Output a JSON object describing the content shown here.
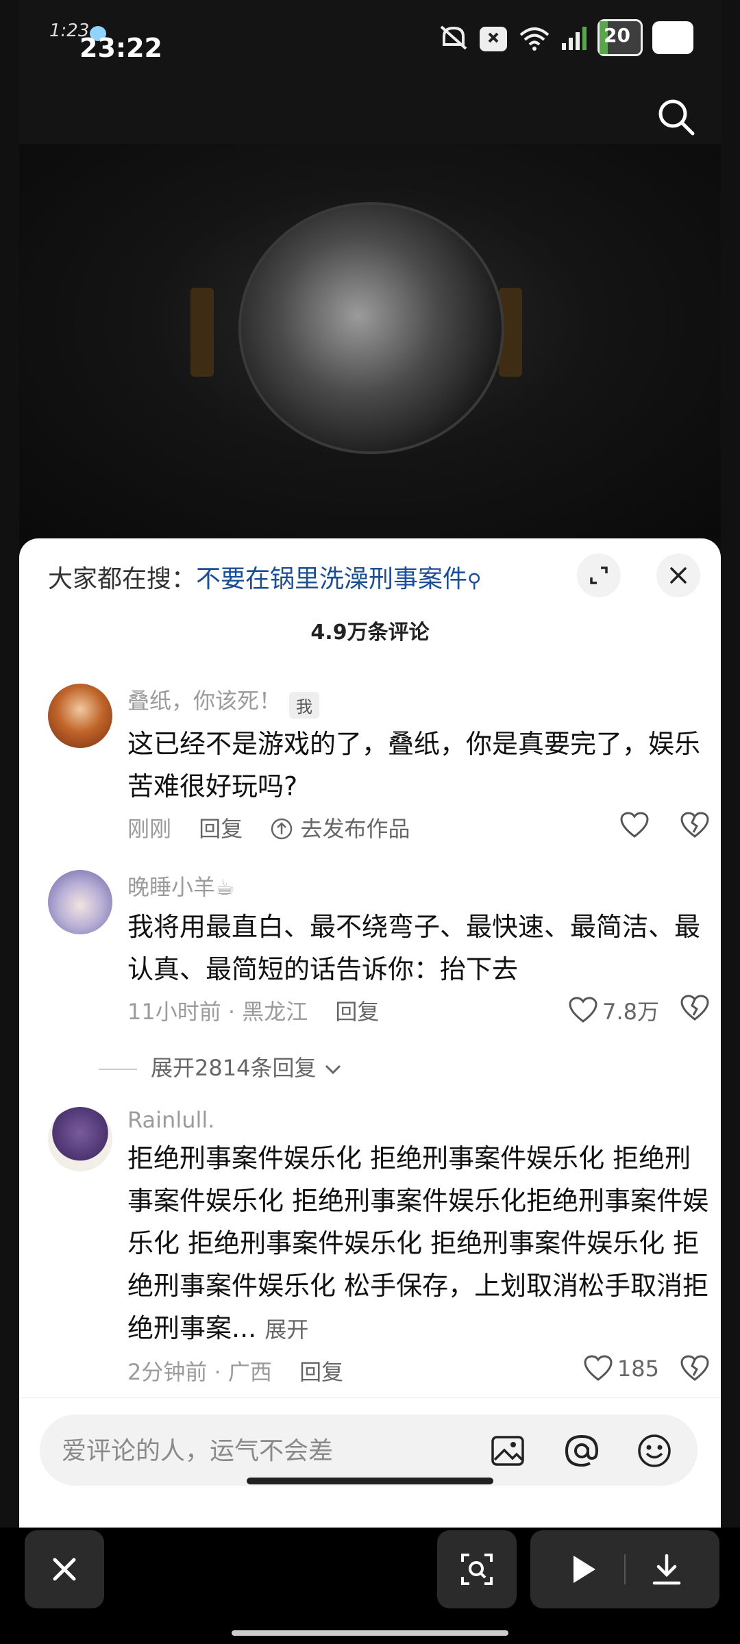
{
  "status_bar": {
    "small_time": "1:23",
    "time": "23:22",
    "battery": "20",
    "battery_level": 0.2
  },
  "hot_search": {
    "prefix": "大家都在搜：",
    "keyword": "不要在锅里洗澡刑事案件"
  },
  "comment_count": "4.9万条评论",
  "comments": [
    {
      "username": "叠纸，你该死！",
      "tag": "我",
      "text": "这已经不是游戏的了，叠纸，你是真要完了，娱乐苦难很好玩吗?",
      "time": "刚刚",
      "reply": "回复",
      "publish": "去发布作品",
      "likes": ""
    },
    {
      "username": "晚睡小羊☕",
      "text": "我将用最直白、最不绕弯子、最快速、最简洁、最认真、最简短的话告诉你：抬下去",
      "time": "11小时前 · 黑龙江",
      "reply": "回复",
      "likes": "7.8万",
      "expand_replies": "展开2814条回复"
    },
    {
      "username": "Rainlull.",
      "text": "拒绝刑事案件娱乐化 拒绝刑事案件娱乐化 拒绝刑事案件娱乐化 拒绝刑事案件娱乐化拒绝刑事案件娱乐化 拒绝刑事案件娱乐化 拒绝刑事案件娱乐化 拒绝刑事案件娱乐化 松手保存，上划取消松手取消拒绝刑事案...",
      "expand": "展开",
      "time": "2分钟前 · 广西",
      "reply": "回复",
      "likes": "185"
    }
  ],
  "input": {
    "placeholder": "爱评论的人，运气不会差"
  },
  "icons": {
    "search": "search-icon",
    "expand": "expand-icon",
    "close": "close-icon",
    "image": "image-icon",
    "at": "at-icon",
    "emoji": "emoji-icon",
    "like": "heart-icon",
    "dislike": "broken-heart-icon",
    "scan": "scan-icon",
    "play": "play-icon",
    "download": "download-icon"
  },
  "colors": {
    "keyword": "#1c4e96",
    "sheet": "#ffffff",
    "toolbar": "#000000"
  }
}
